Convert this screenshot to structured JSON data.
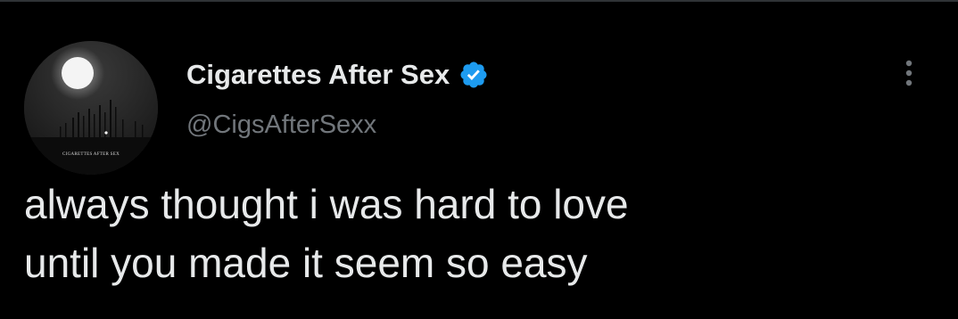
{
  "user": {
    "display_name": "Cigarettes After Sex",
    "handle": "@CigsAfterSexx",
    "avatar_caption": "CIGARETTES AFTER SEX",
    "verified_color": "#1d9bf0"
  },
  "tweet": {
    "lines": [
      "always thought i was hard to love",
      "until you made it seem so easy"
    ]
  },
  "icons": {
    "verified": "verified-badge-icon",
    "more": "more-options-icon"
  },
  "colors": {
    "background": "#000000",
    "text_primary": "#e7e9ea",
    "text_secondary": "#71767b",
    "accent": "#1d9bf0"
  }
}
